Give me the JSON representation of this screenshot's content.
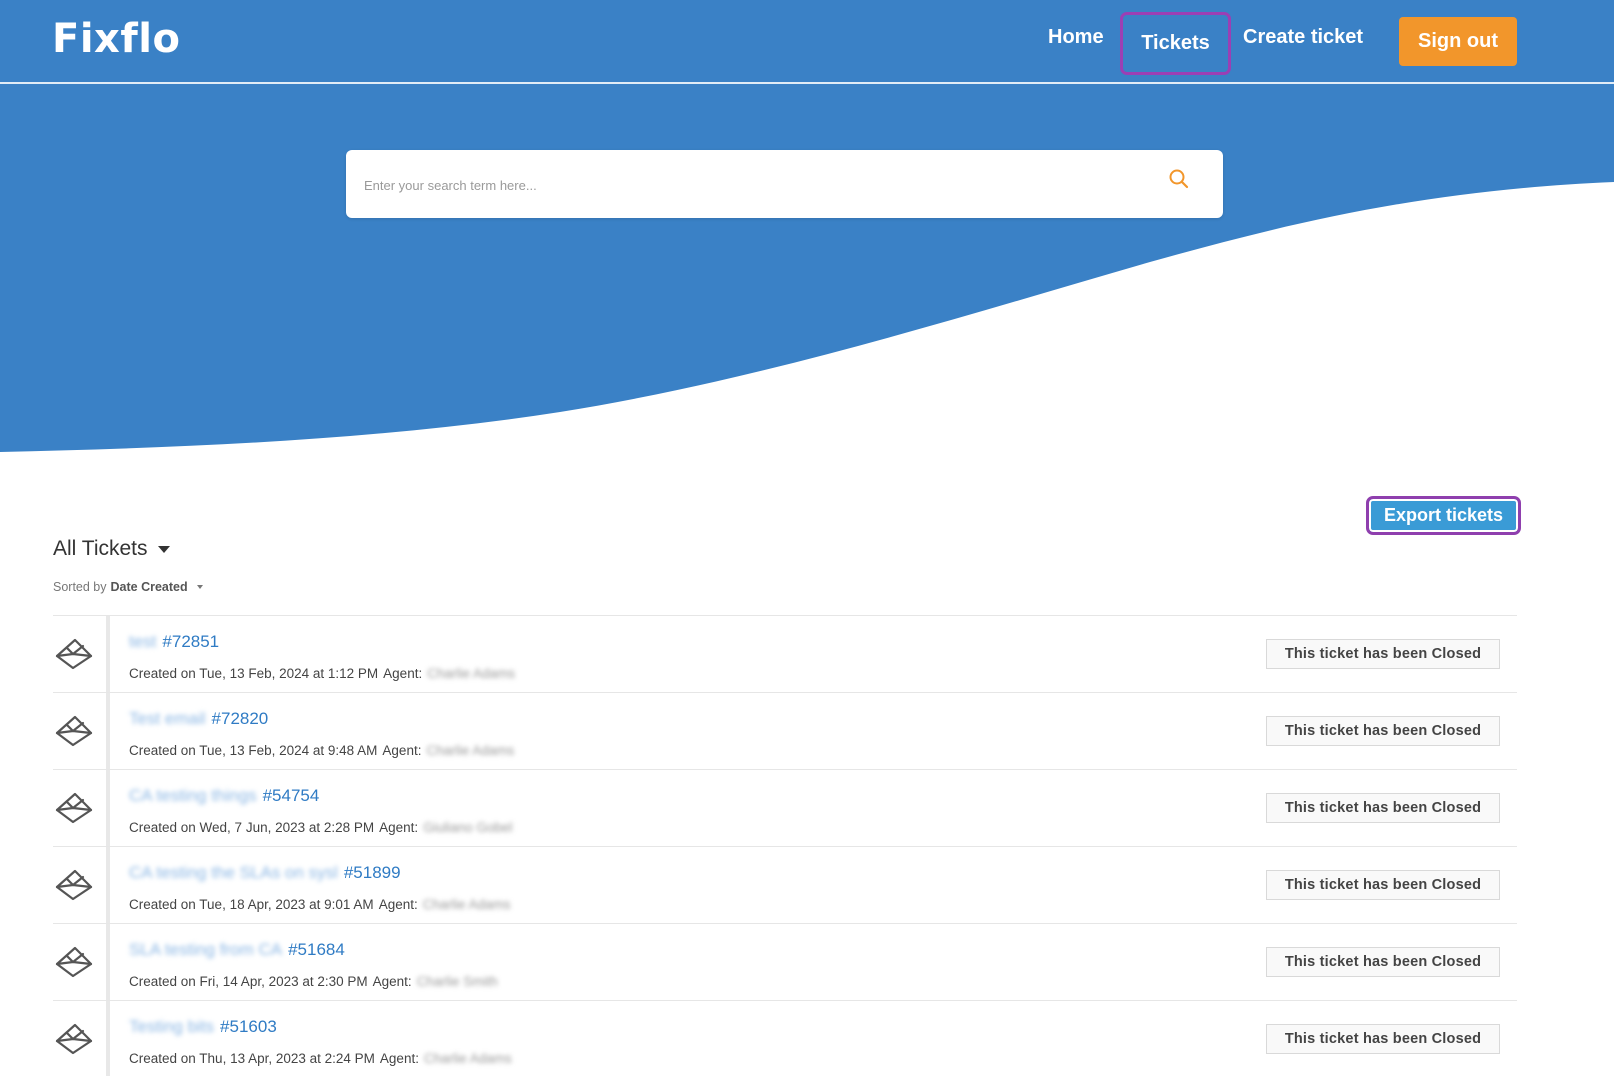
{
  "header": {
    "logo": "Fixflo",
    "nav": {
      "home": "Home",
      "tickets": "Tickets",
      "create_ticket": "Create ticket",
      "sign_out": "Sign out"
    }
  },
  "search": {
    "placeholder": "Enter your search term here..."
  },
  "colors": {
    "brand_blue": "#3a81c6",
    "sign_out_orange": "#f2962b",
    "export_blue": "#3a9bd6",
    "focus_purple": "#9b3fb4",
    "link_blue": "#2f7bc4"
  },
  "actions": {
    "export": "Export tickets"
  },
  "list": {
    "filter_label": "All Tickets",
    "sorted_prefix": "Sorted by",
    "sorted_field": "Date Created"
  },
  "tickets": [
    {
      "title": "test",
      "number": "#72851",
      "created": "Created on Tue, 13 Feb, 2024 at 1:12 PM",
      "agent_label": "Agent:",
      "agent": "Charlie Adams",
      "status": "This ticket has been Closed"
    },
    {
      "title": "Test email",
      "number": "#72820",
      "created": "Created on Tue, 13 Feb, 2024 at 9:48 AM",
      "agent_label": "Agent:",
      "agent": "Charlie Adams",
      "status": "This ticket has been Closed"
    },
    {
      "title": "CA testing things",
      "number": "#54754",
      "created": "Created on Wed, 7 Jun, 2023 at 2:28 PM",
      "agent_label": "Agent:",
      "agent": "Giuliano Gobel",
      "status": "This ticket has been Closed"
    },
    {
      "title": "CA testing the SLAs on sysl",
      "number": "#51899",
      "created": "Created on Tue, 18 Apr, 2023 at 9:01 AM",
      "agent_label": "Agent:",
      "agent": "Charlie Adams",
      "status": "This ticket has been Closed"
    },
    {
      "title": "SLA testing from CA",
      "number": "#51684",
      "created": "Created on Fri, 14 Apr, 2023 at 2:30 PM",
      "agent_label": "Agent:",
      "agent": "Charlie Smith",
      "status": "This ticket has been Closed"
    },
    {
      "title": "Testing bits",
      "number": "#51603",
      "created": "Created on Thu, 13 Apr, 2023 at 2:24 PM",
      "agent_label": "Agent:",
      "agent": "Charlie Adams",
      "status": "This ticket has been Closed"
    }
  ]
}
